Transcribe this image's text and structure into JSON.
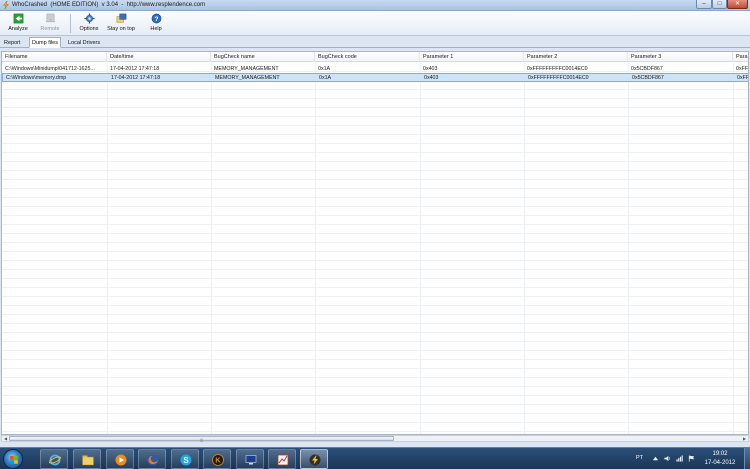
{
  "window": {
    "title": "WhoCrashed  (HOME EDITION)  v 3.04  -  http://www.resplendence.com",
    "controls": {
      "minimize": "–",
      "maximize": "□",
      "close": "✕"
    }
  },
  "toolbar": {
    "analyze_label": "Analyze",
    "remote_label": "Remote",
    "options_label": "Options",
    "stay_on_top_label": "Stay on top",
    "help_label": "Help"
  },
  "tabs": [
    {
      "label": "Report"
    },
    {
      "label": "Dump files"
    },
    {
      "label": "Local Drivers"
    }
  ],
  "table": {
    "columns": [
      "Filename",
      "Date/time",
      "BugCheck name",
      "BugCheck code",
      "Parameter 1",
      "Parameter 2",
      "Parameter 3",
      "Para"
    ],
    "rows": [
      [
        "C:\\Windows\\Minidump\\041712-1625...",
        "17-04-2012 17:47:18",
        "MEMORY_MANAGEMENT",
        "0x1A",
        "0x403",
        "0xFFFFFFFFFC0014EC0",
        "0x5CBDF867",
        "0xFF"
      ],
      [
        "C:\\Windows\\memory.dmp",
        "17-04-2012 17:47:18",
        "MEMORY_MANAGEMENT",
        "0x1A",
        "0x403",
        "0xFFFFFFFFFC0014EC0",
        "0x5CBDF867",
        "0xFF"
      ]
    ]
  },
  "taskbar": {
    "apps": [
      "internet-explorer",
      "windows-explorer",
      "media-player",
      "firefox",
      "skype",
      "k-app",
      "remote-desktop",
      "system-monitor",
      "whocrashed"
    ],
    "language": "PT",
    "time": "19:02",
    "date": "17-04-2012"
  }
}
